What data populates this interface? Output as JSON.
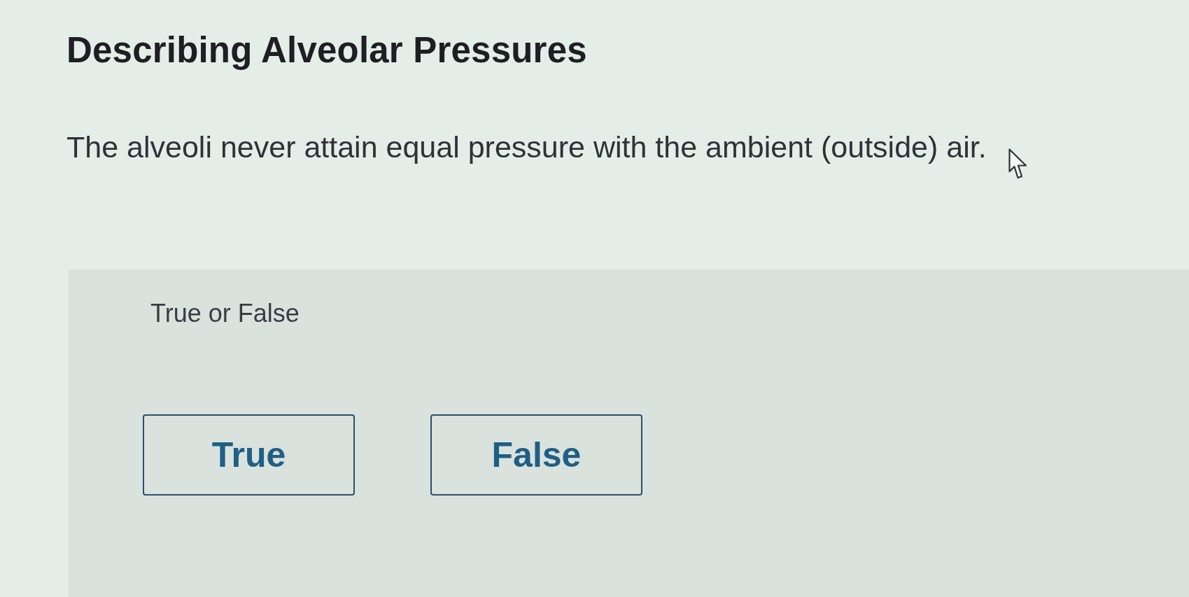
{
  "title": "Describing Alveolar Pressures",
  "question": "The alveoli never attain equal pressure with the ambient (outside) air.",
  "answer_panel": {
    "prompt": "True or False",
    "choices": [
      {
        "label": "True",
        "selected": false
      },
      {
        "label": "False",
        "selected": false
      }
    ]
  }
}
